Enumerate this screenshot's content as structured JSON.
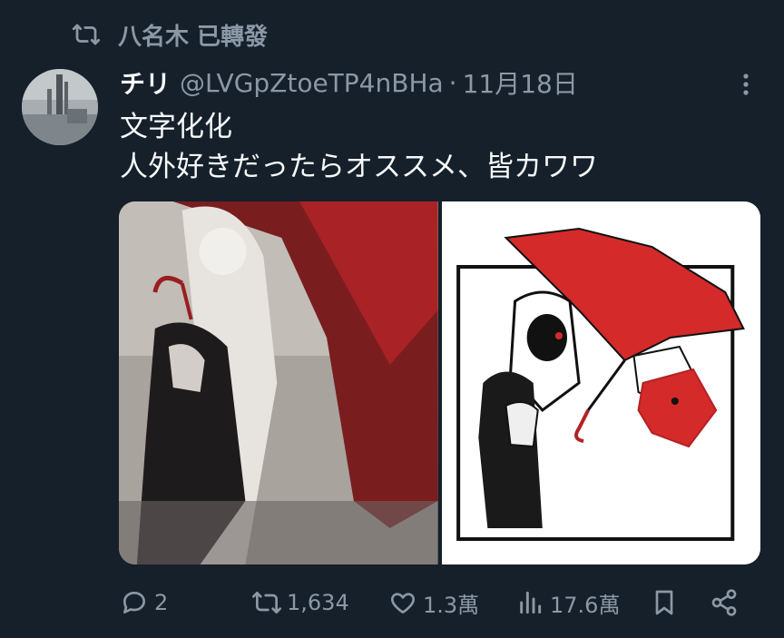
{
  "social_context": {
    "icon": "retweet-icon",
    "text": "八名木 已轉發"
  },
  "author": {
    "display_name": "チリ",
    "handle": "@LVGpZtoeTP4nBHa",
    "separator": "·",
    "date": "11月18日"
  },
  "tweet": {
    "lines": [
      "文字化化",
      "人外好きだったらオススメ、皆カワワ"
    ]
  },
  "colors": {
    "background": "#15202b",
    "text_primary": "#f7f9f9",
    "text_secondary": "#8b98a5",
    "umbrella_red": "#d42a2a"
  },
  "actions": {
    "reply": {
      "icon": "reply-icon",
      "count": "2"
    },
    "retweet": {
      "icon": "retweet-icon",
      "count": "1,634"
    },
    "like": {
      "icon": "heart-icon",
      "count": "1.3萬"
    },
    "views": {
      "icon": "views-icon",
      "count": "17.6萬"
    },
    "bookmark": {
      "icon": "bookmark-icon"
    },
    "share": {
      "icon": "share-icon"
    }
  }
}
